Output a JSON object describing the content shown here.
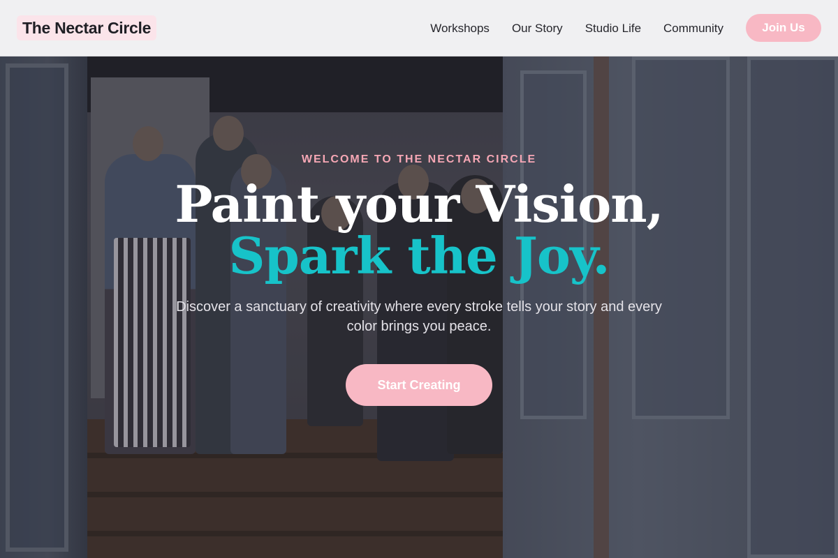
{
  "brand": {
    "name": "The Nectar Circle"
  },
  "nav": {
    "items": [
      {
        "label": "Workshops"
      },
      {
        "label": "Our Story"
      },
      {
        "label": "Studio Life"
      },
      {
        "label": "Community"
      }
    ],
    "join_label": "Join Us"
  },
  "hero": {
    "eyebrow": "WELCOME TO THE NECTAR CIRCLE",
    "headline_line1": "Paint your Vision,",
    "headline_line2": "Spark the Joy.",
    "subtext": "Discover a sanctuary of creativity where every stroke tells your story and every color brings you peace.",
    "cta_label": "Start Creating",
    "background_image": "art-studio-gallery-photo"
  },
  "colors": {
    "accent_pink": "#f8b8c4",
    "eyebrow_pink": "#f6a7b5",
    "accent_teal": "#17c3c9",
    "header_bg": "#f0f0f2"
  }
}
